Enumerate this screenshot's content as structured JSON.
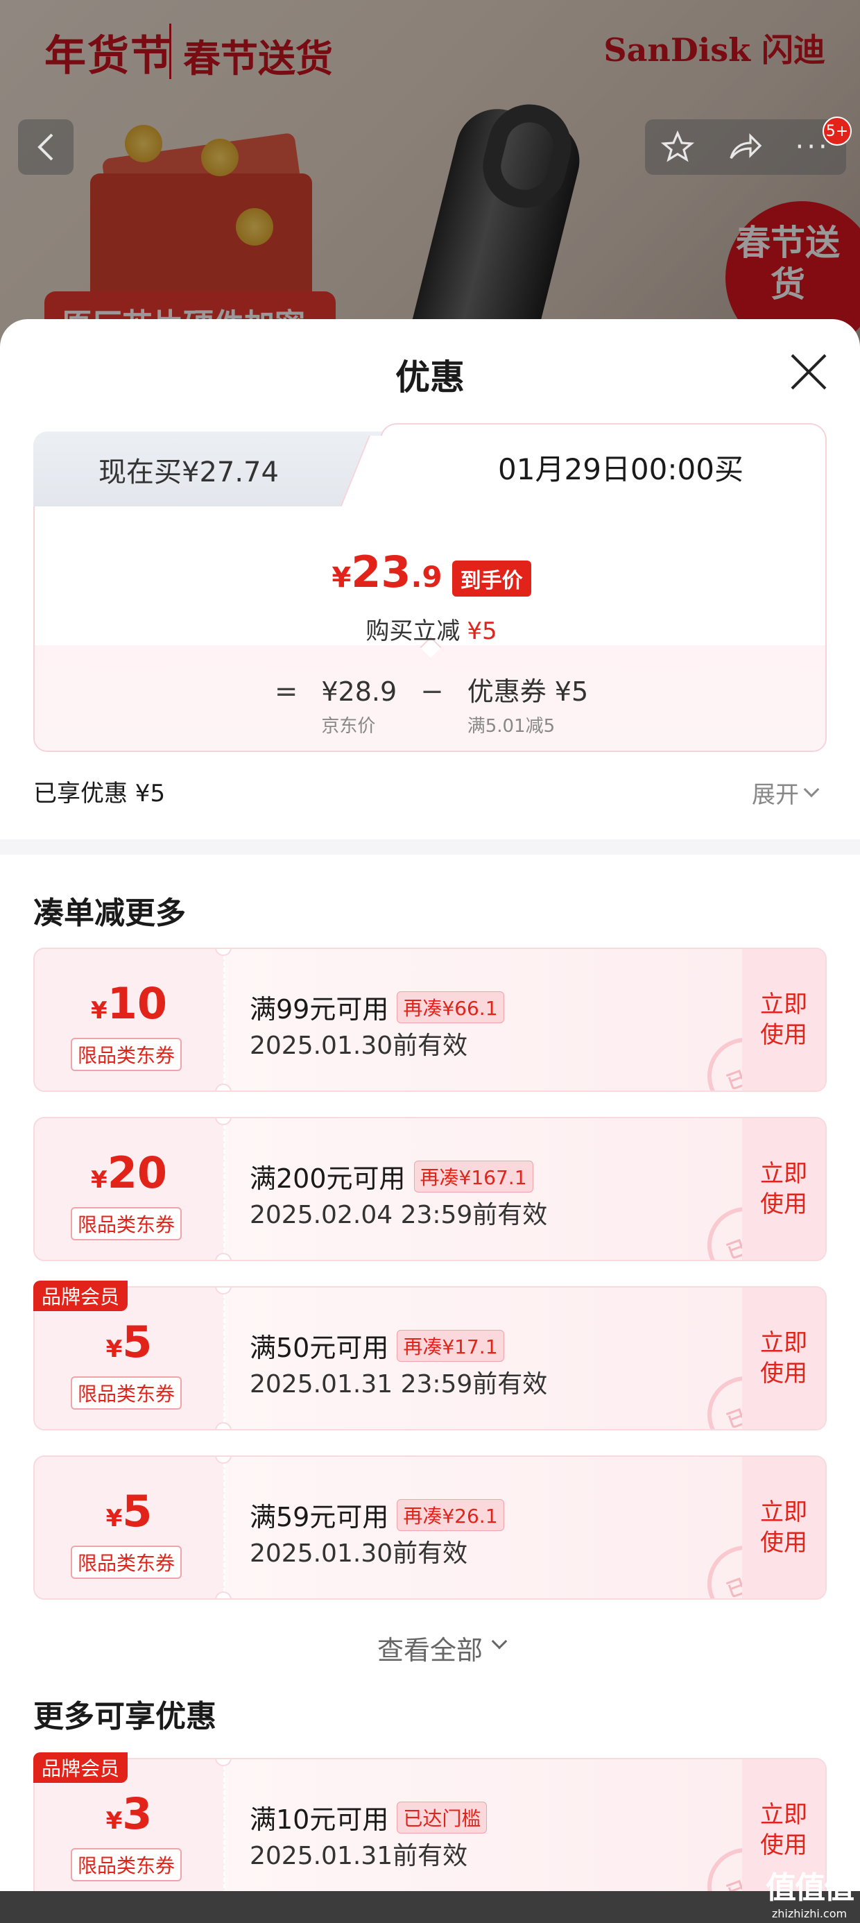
{
  "banner": {
    "brand_left": "年货节",
    "brand_mid": "春节送货",
    "brand_right": "SanDisk 闪迪",
    "promo_strip": "原厂芯片硬件加密",
    "seal": "春节送货",
    "actions_badge": "5+"
  },
  "sheet": {
    "title": "优惠"
  },
  "price_card": {
    "tab_now": "现在买¥27.74",
    "tab_later": "01月29日00:00买",
    "final_price": {
      "yen": "¥",
      "int": "23",
      "dec": ".9"
    },
    "final_tag": "到手价",
    "instant_off_label": "购买立减",
    "instant_off_value": "¥5",
    "eq": "=",
    "minus": "−",
    "jd_price": "¥28.9",
    "jd_price_label": "京东价",
    "coupon_value": "优惠券 ¥5",
    "coupon_rule": "满5.01减5"
  },
  "enjoyed": "已享优惠 ¥5",
  "expand": "展开",
  "section_more": "凑单减更多",
  "coupons": [
    {
      "yen": "¥",
      "amount": "10",
      "type": "限品类东券",
      "cond": "满99元可用",
      "gap": "再凑¥66.1",
      "valid": "2025.01.30前有效",
      "use1": "立即",
      "use2": "使用",
      "stamp": "已领"
    },
    {
      "yen": "¥",
      "amount": "20",
      "type": "限品类东券",
      "cond": "满200元可用",
      "gap": "再凑¥167.1",
      "valid": "2025.02.04 23:59前有效",
      "use1": "立即",
      "use2": "使用",
      "stamp": "已领"
    },
    {
      "tag": "品牌会员",
      "yen": "¥",
      "amount": "5",
      "type": "限品类东券",
      "cond": "满50元可用",
      "gap": "再凑¥17.1",
      "valid": "2025.01.31 23:59前有效",
      "use1": "立即",
      "use2": "使用",
      "stamp": "已领"
    },
    {
      "yen": "¥",
      "amount": "5",
      "type": "限品类东券",
      "cond": "满59元可用",
      "gap": "再凑¥26.1",
      "valid": "2025.01.30前有效",
      "use1": "立即",
      "use2": "使用",
      "stamp": "已领"
    }
  ],
  "see_all": "查看全部",
  "section_extra": "更多可享优惠",
  "extra_coupon": {
    "tag": "品牌会员",
    "yen": "¥",
    "amount": "3",
    "type": "限品类东券",
    "cond": "满10元可用",
    "gap": "已达门槛",
    "valid": "2025.01.31前有效",
    "use1": "立即",
    "use2": "使用",
    "stamp": "已领"
  },
  "watermark": {
    "line1": "值值值",
    "line2": "zhizhizhi.com"
  },
  "colors": {
    "accent": "#e2231a",
    "coupon_bg": "#fdeff1",
    "border": "#f8d9de"
  }
}
